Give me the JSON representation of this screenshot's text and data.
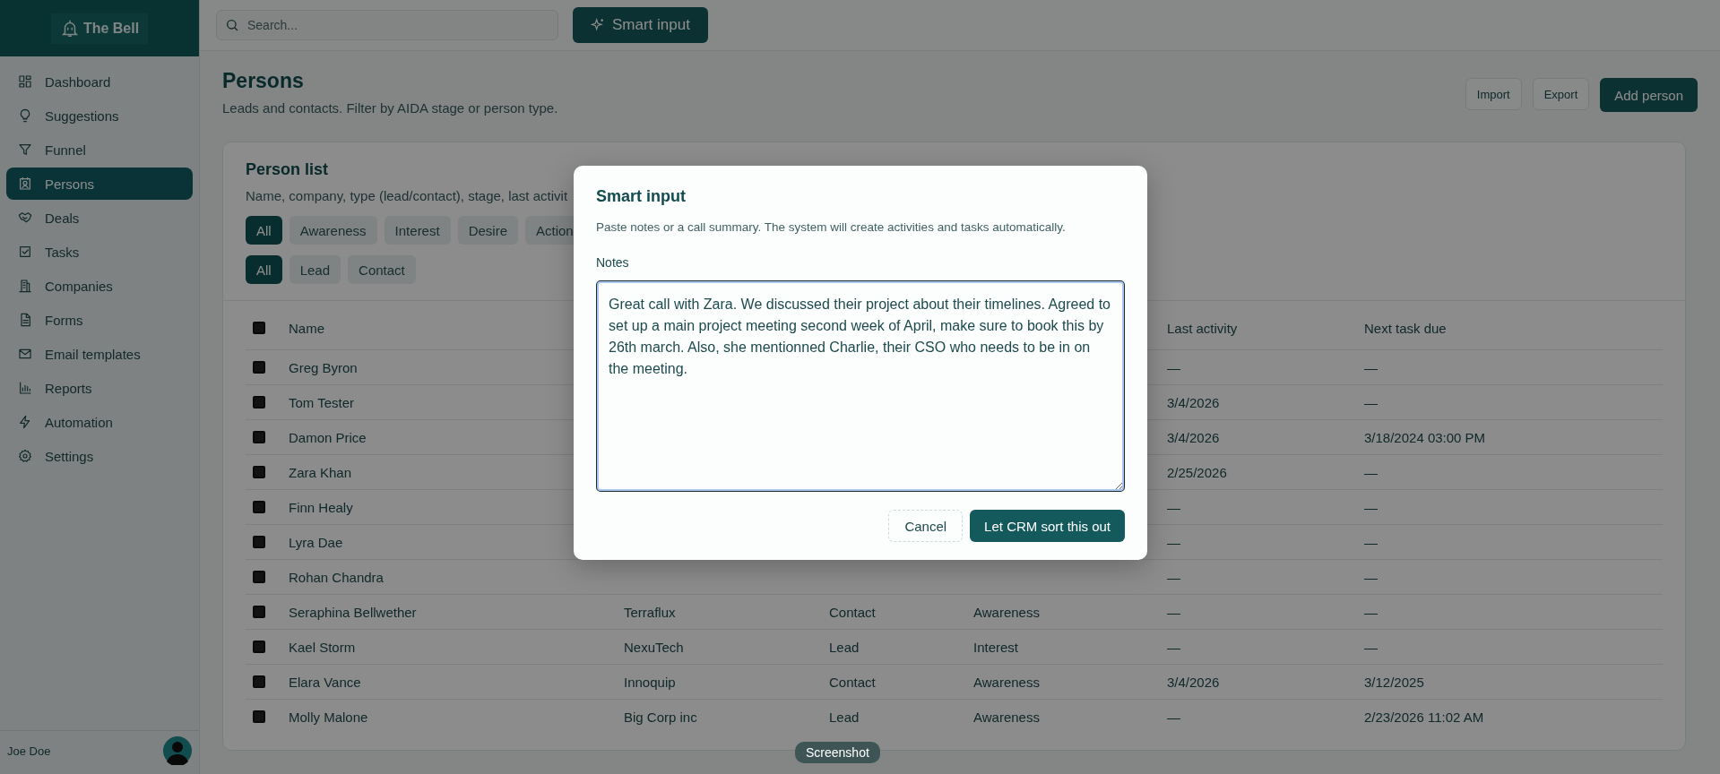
{
  "app": {
    "logo": "The Bell"
  },
  "sidebar": {
    "items": [
      {
        "label": "Dashboard",
        "selected": false
      },
      {
        "label": "Suggestions",
        "selected": false
      },
      {
        "label": "Funnel",
        "selected": false
      },
      {
        "label": "Persons",
        "selected": true
      },
      {
        "label": "Deals",
        "selected": false
      },
      {
        "label": "Tasks",
        "selected": false
      },
      {
        "label": "Companies",
        "selected": false
      },
      {
        "label": "Forms",
        "selected": false
      },
      {
        "label": "Email templates",
        "selected": false
      },
      {
        "label": "Reports",
        "selected": false
      },
      {
        "label": "Automation",
        "selected": false
      },
      {
        "label": "Settings",
        "selected": false
      }
    ],
    "user": {
      "name": "Joe Doe"
    }
  },
  "topbar": {
    "search": {
      "placeholder": "Search..."
    },
    "smart_input_button": "Smart input"
  },
  "page": {
    "title": "Persons",
    "subtitle": "Leads and contacts. Filter by AIDA stage or person type.",
    "actions": [
      {
        "label": "Import",
        "kind": "secondary"
      },
      {
        "label": "Export",
        "kind": "secondary"
      },
      {
        "label": "Add person",
        "kind": "primary"
      }
    ]
  },
  "person_list": {
    "title": "Person list",
    "description": "Name, company, type (lead/contact), stage, last activit",
    "stage_filters": [
      {
        "label": "All",
        "selected": true
      },
      {
        "label": "Awareness",
        "selected": false
      },
      {
        "label": "Interest",
        "selected": false
      },
      {
        "label": "Desire",
        "selected": false
      },
      {
        "label": "Action",
        "selected": false
      }
    ],
    "type_filters": [
      {
        "label": "All",
        "selected": true
      },
      {
        "label": "Lead",
        "selected": false
      },
      {
        "label": "Contact",
        "selected": false
      }
    ],
    "table": {
      "select_all_checked": false,
      "columns": [
        "Name",
        null,
        null,
        null,
        "Last activity",
        "Next task due"
      ],
      "rows": [
        {
          "checked": false,
          "cells": [
            "Greg Byron",
            null,
            null,
            null,
            "—",
            "—"
          ]
        },
        {
          "checked": false,
          "cells": [
            "Tom Tester",
            null,
            null,
            null,
            "3/4/2026",
            "—"
          ]
        },
        {
          "checked": false,
          "cells": [
            "Damon Price",
            null,
            null,
            null,
            "3/4/2026",
            "3/18/2024 03:00 PM"
          ]
        },
        {
          "checked": false,
          "cells": [
            "Zara Khan",
            null,
            null,
            null,
            "2/25/2026",
            "—"
          ]
        },
        {
          "checked": false,
          "cells": [
            "Finn Healy",
            null,
            null,
            null,
            "—",
            "—"
          ]
        },
        {
          "checked": false,
          "cells": [
            "Lyra Dae",
            null,
            null,
            null,
            "—",
            "—"
          ]
        },
        {
          "checked": false,
          "cells": [
            "Rohan Chandra",
            null,
            null,
            null,
            "—",
            "—"
          ]
        },
        {
          "checked": false,
          "cells": [
            "Seraphina Bellwether",
            "Terraflux",
            "Contact",
            "Awareness",
            "—",
            "—"
          ]
        },
        {
          "checked": false,
          "cells": [
            "Kael Storm",
            "NexuTech",
            "Lead",
            "Interest",
            "—",
            "—"
          ]
        },
        {
          "checked": false,
          "cells": [
            "Elara Vance",
            "Innoquip",
            "Contact",
            "Awareness",
            "3/4/2026",
            "3/12/2025"
          ]
        },
        {
          "checked": false,
          "cells": [
            "Molly Malone",
            "Big Corp inc",
            "Lead",
            "Awareness",
            "—",
            "2/23/2026 11:02 AM"
          ]
        }
      ]
    }
  },
  "modal": {
    "title": "Smart input",
    "description": "Paste notes or a call summary. The system will create activities and tasks automatically.",
    "notes_label": "Notes",
    "notes_value": "Great call with Zara. We discussed their project about their timelines. Agreed to set up a main project meeting second week of April, make sure to book this by 26th march. Also, she mentionned Charlie, their CSO who needs to be in on the meeting.",
    "buttons": [
      {
        "label": "Cancel",
        "kind": "secondary"
      },
      {
        "label": "Let CRM sort this out",
        "kind": "primary"
      }
    ]
  },
  "tooltip": "Screenshot"
}
